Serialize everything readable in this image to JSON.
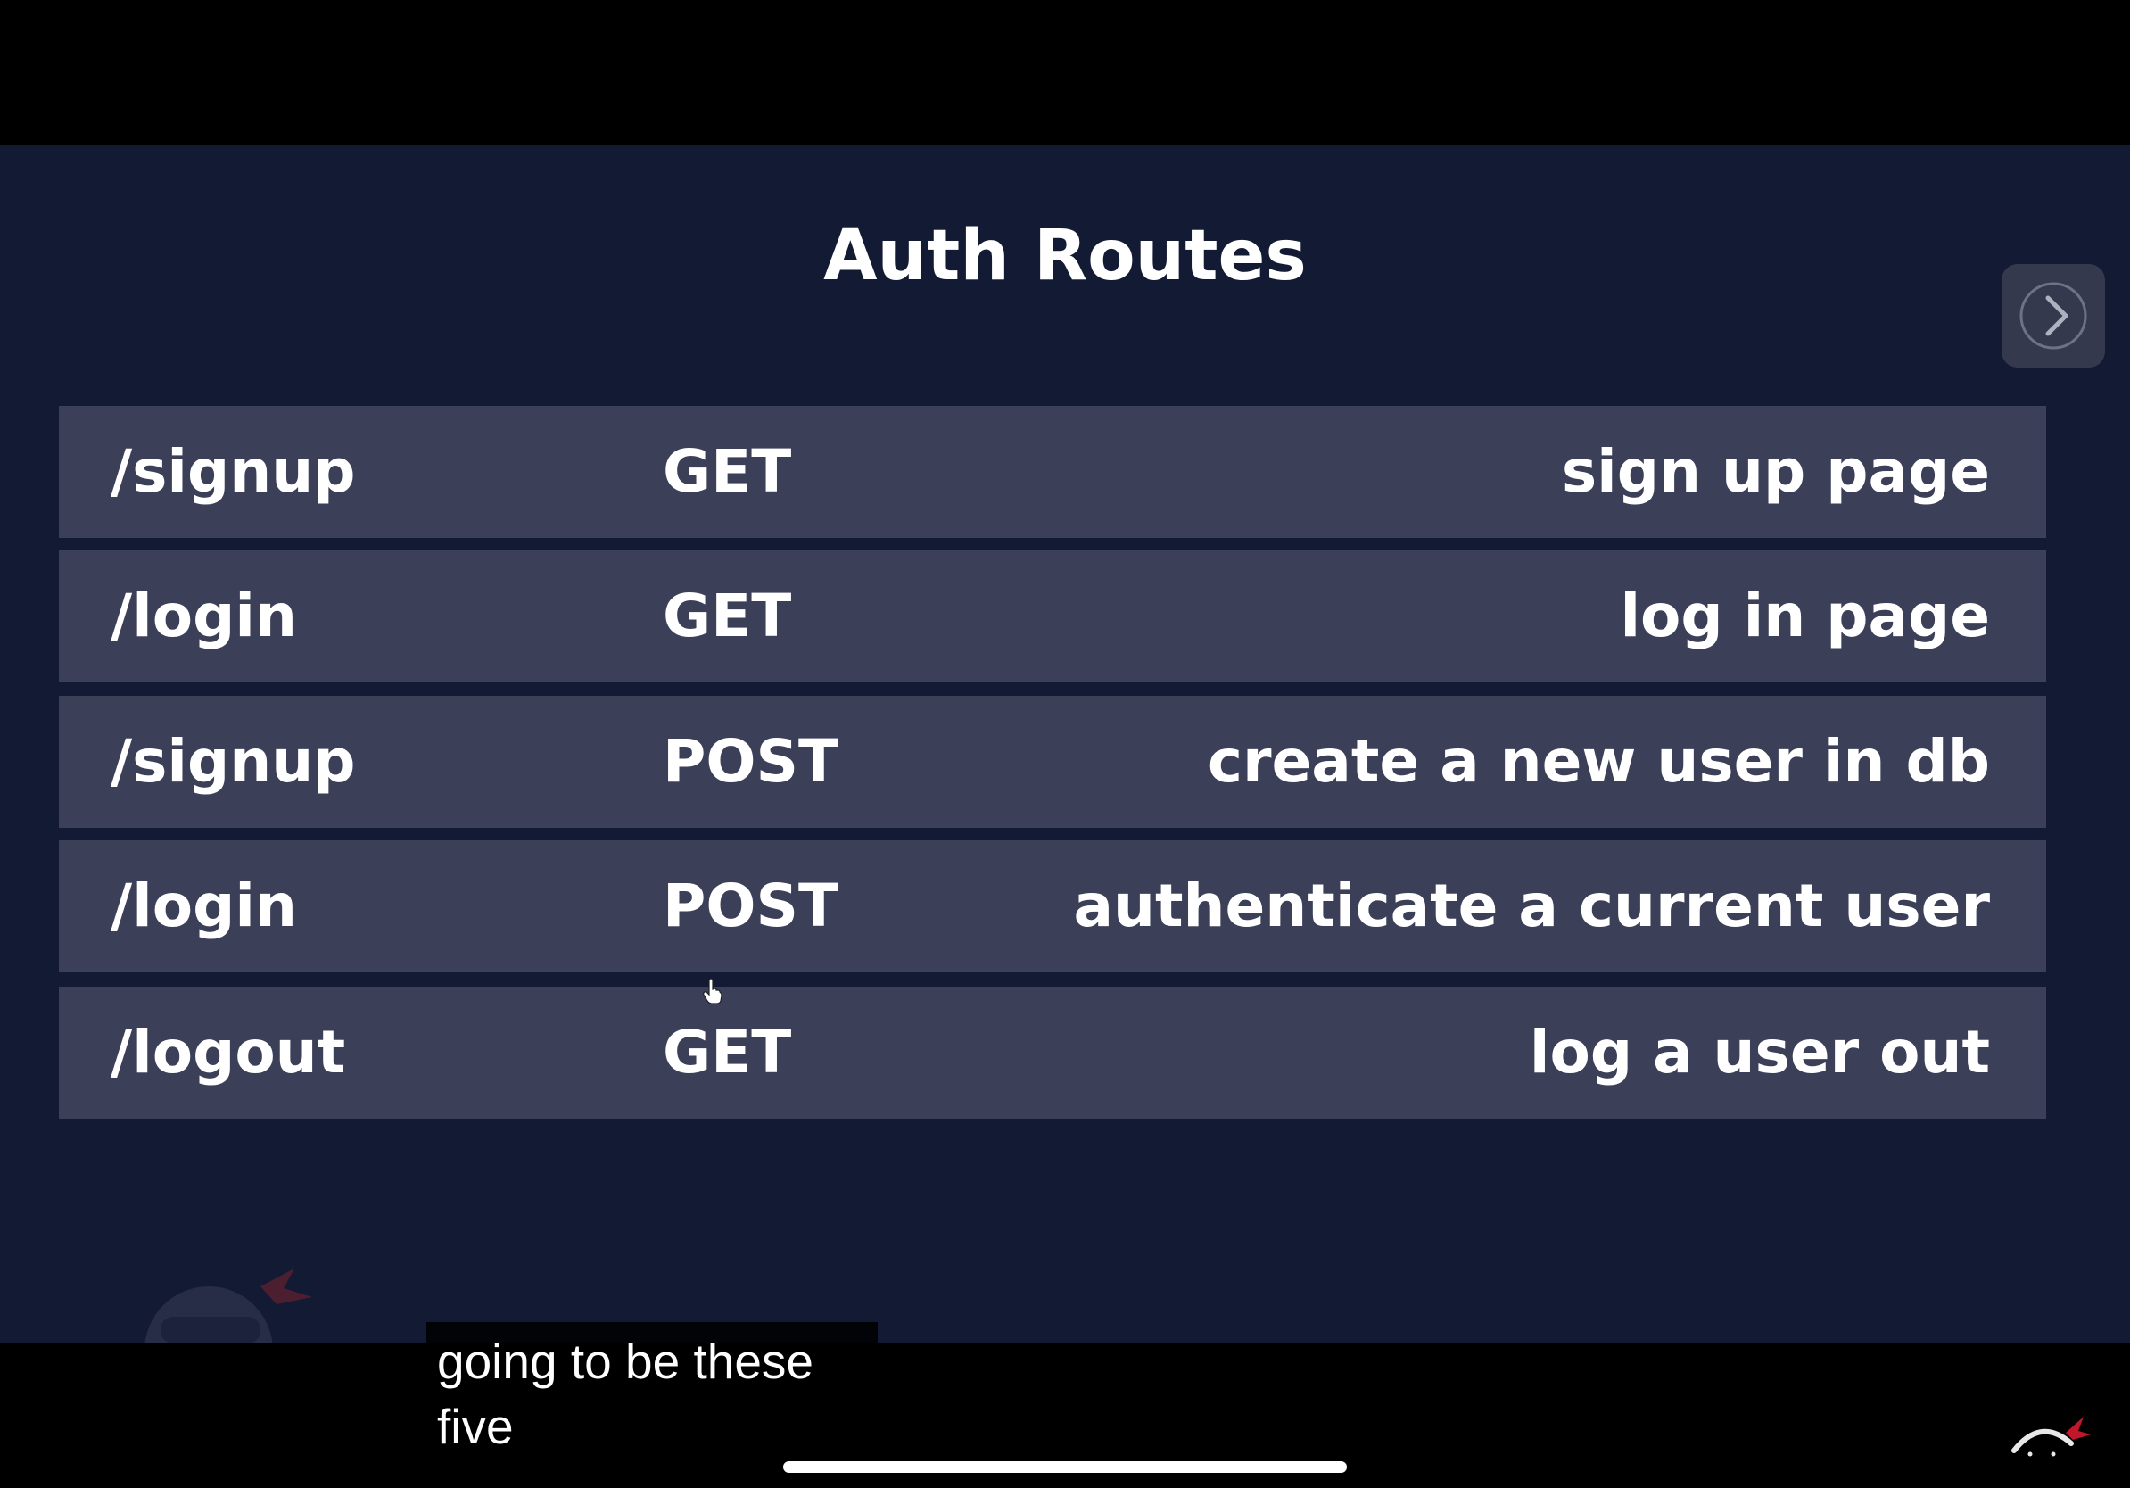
{
  "slide": {
    "title": "Auth Routes",
    "routes": [
      {
        "path": "/signup",
        "method": "GET",
        "description": "sign up page"
      },
      {
        "path": "/login",
        "method": "GET",
        "description": "log in page"
      },
      {
        "path": "/signup",
        "method": "POST",
        "description": "create a new user in db"
      },
      {
        "path": "/login",
        "method": "POST",
        "description": "authenticate a current user"
      },
      {
        "path": "/logout",
        "method": "GET",
        "description": "log a user out"
      }
    ]
  },
  "caption": {
    "line1": "going to be these",
    "line2": "five"
  },
  "icons": {
    "next": "chevron-right-icon",
    "cursor": "hand-pointer-icon",
    "mascot": "ninja-mascot-icon"
  },
  "colors": {
    "slide_background": "#131a33",
    "row_background": "#3b3f58",
    "text": "#ffffff",
    "mascot_accent": "#c0182a"
  }
}
